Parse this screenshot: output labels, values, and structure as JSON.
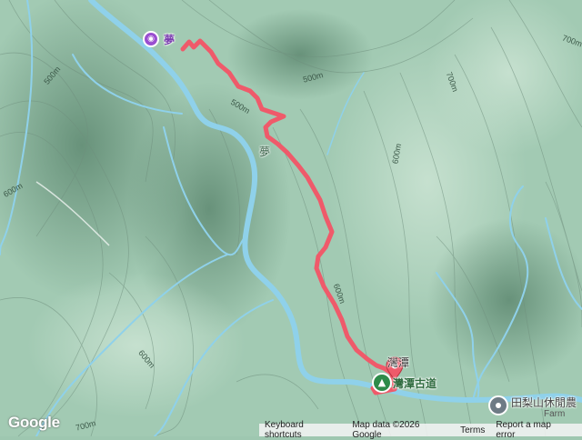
{
  "map": {
    "contour_labels": [
      "500m",
      "500m",
      "500m",
      "600m",
      "600m",
      "600m",
      "700m",
      "700m",
      "700m",
      "600m"
    ],
    "places": {
      "photo_label": "夢",
      "trail_label_1": "夢",
      "village": "灣潭",
      "trail_name": "灣潭古道",
      "farm_name": "田梨山休閒農",
      "farm_type": "Farm"
    },
    "icons": {
      "photo": "camera-icon",
      "trailhead": "hiking-trail-icon",
      "farm": "farm-pin-icon",
      "end": "destination-marker-icon"
    },
    "colors": {
      "terrain": "#9ec7b0",
      "river": "#8fd1ea",
      "route": "#ef5a6a",
      "contour": "#6f8f7d"
    }
  },
  "attribution": {
    "logo": "Google",
    "shortcuts": "Keyboard shortcuts",
    "map_data": "Map data ©2026 Google",
    "terms": "Terms",
    "report": "Report a map error"
  }
}
